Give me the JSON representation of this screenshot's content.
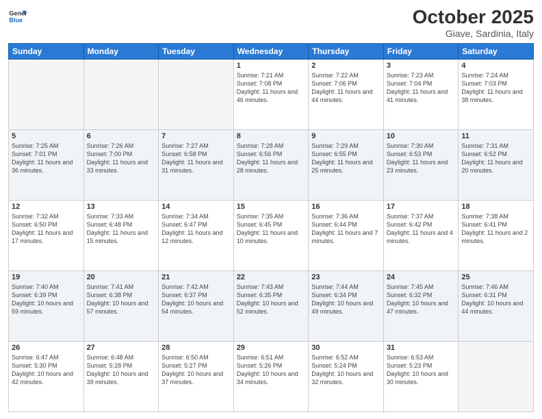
{
  "header": {
    "logo_line1": "General",
    "logo_line2": "Blue",
    "month_title": "October 2025",
    "location": "Giave, Sardinia, Italy"
  },
  "weekdays": [
    "Sunday",
    "Monday",
    "Tuesday",
    "Wednesday",
    "Thursday",
    "Friday",
    "Saturday"
  ],
  "weeks": [
    [
      {
        "day": "",
        "sunrise": "",
        "sunset": "",
        "daylight": ""
      },
      {
        "day": "",
        "sunrise": "",
        "sunset": "",
        "daylight": ""
      },
      {
        "day": "",
        "sunrise": "",
        "sunset": "",
        "daylight": ""
      },
      {
        "day": "1",
        "sunrise": "7:21 AM",
        "sunset": "7:08 PM",
        "daylight": "11 hours and 46 minutes."
      },
      {
        "day": "2",
        "sunrise": "7:22 AM",
        "sunset": "7:06 PM",
        "daylight": "11 hours and 44 minutes."
      },
      {
        "day": "3",
        "sunrise": "7:23 AM",
        "sunset": "7:04 PM",
        "daylight": "11 hours and 41 minutes."
      },
      {
        "day": "4",
        "sunrise": "7:24 AM",
        "sunset": "7:03 PM",
        "daylight": "11 hours and 38 minutes."
      }
    ],
    [
      {
        "day": "5",
        "sunrise": "7:25 AM",
        "sunset": "7:01 PM",
        "daylight": "11 hours and 36 minutes."
      },
      {
        "day": "6",
        "sunrise": "7:26 AM",
        "sunset": "7:00 PM",
        "daylight": "11 hours and 33 minutes."
      },
      {
        "day": "7",
        "sunrise": "7:27 AM",
        "sunset": "6:58 PM",
        "daylight": "11 hours and 31 minutes."
      },
      {
        "day": "8",
        "sunrise": "7:28 AM",
        "sunset": "6:56 PM",
        "daylight": "11 hours and 28 minutes."
      },
      {
        "day": "9",
        "sunrise": "7:29 AM",
        "sunset": "6:55 PM",
        "daylight": "11 hours and 25 minutes."
      },
      {
        "day": "10",
        "sunrise": "7:30 AM",
        "sunset": "6:53 PM",
        "daylight": "11 hours and 23 minutes."
      },
      {
        "day": "11",
        "sunrise": "7:31 AM",
        "sunset": "6:52 PM",
        "daylight": "11 hours and 20 minutes."
      }
    ],
    [
      {
        "day": "12",
        "sunrise": "7:32 AM",
        "sunset": "6:50 PM",
        "daylight": "11 hours and 17 minutes."
      },
      {
        "day": "13",
        "sunrise": "7:33 AM",
        "sunset": "6:48 PM",
        "daylight": "11 hours and 15 minutes."
      },
      {
        "day": "14",
        "sunrise": "7:34 AM",
        "sunset": "6:47 PM",
        "daylight": "11 hours and 12 minutes."
      },
      {
        "day": "15",
        "sunrise": "7:35 AM",
        "sunset": "6:45 PM",
        "daylight": "11 hours and 10 minutes."
      },
      {
        "day": "16",
        "sunrise": "7:36 AM",
        "sunset": "6:44 PM",
        "daylight": "11 hours and 7 minutes."
      },
      {
        "day": "17",
        "sunrise": "7:37 AM",
        "sunset": "6:42 PM",
        "daylight": "11 hours and 4 minutes."
      },
      {
        "day": "18",
        "sunrise": "7:38 AM",
        "sunset": "6:41 PM",
        "daylight": "11 hours and 2 minutes."
      }
    ],
    [
      {
        "day": "19",
        "sunrise": "7:40 AM",
        "sunset": "6:39 PM",
        "daylight": "10 hours and 59 minutes."
      },
      {
        "day": "20",
        "sunrise": "7:41 AM",
        "sunset": "6:38 PM",
        "daylight": "10 hours and 57 minutes."
      },
      {
        "day": "21",
        "sunrise": "7:42 AM",
        "sunset": "6:37 PM",
        "daylight": "10 hours and 54 minutes."
      },
      {
        "day": "22",
        "sunrise": "7:43 AM",
        "sunset": "6:35 PM",
        "daylight": "10 hours and 52 minutes."
      },
      {
        "day": "23",
        "sunrise": "7:44 AM",
        "sunset": "6:34 PM",
        "daylight": "10 hours and 49 minutes."
      },
      {
        "day": "24",
        "sunrise": "7:45 AM",
        "sunset": "6:32 PM",
        "daylight": "10 hours and 47 minutes."
      },
      {
        "day": "25",
        "sunrise": "7:46 AM",
        "sunset": "6:31 PM",
        "daylight": "10 hours and 44 minutes."
      }
    ],
    [
      {
        "day": "26",
        "sunrise": "6:47 AM",
        "sunset": "5:30 PM",
        "daylight": "10 hours and 42 minutes."
      },
      {
        "day": "27",
        "sunrise": "6:48 AM",
        "sunset": "5:28 PM",
        "daylight": "10 hours and 39 minutes."
      },
      {
        "day": "28",
        "sunrise": "6:50 AM",
        "sunset": "5:27 PM",
        "daylight": "10 hours and 37 minutes."
      },
      {
        "day": "29",
        "sunrise": "6:51 AM",
        "sunset": "5:26 PM",
        "daylight": "10 hours and 34 minutes."
      },
      {
        "day": "30",
        "sunrise": "6:52 AM",
        "sunset": "5:24 PM",
        "daylight": "10 hours and 32 minutes."
      },
      {
        "day": "31",
        "sunrise": "6:53 AM",
        "sunset": "5:23 PM",
        "daylight": "10 hours and 30 minutes."
      },
      {
        "day": "",
        "sunrise": "",
        "sunset": "",
        "daylight": ""
      }
    ]
  ],
  "labels": {
    "sunrise_prefix": "Sunrise: ",
    "sunset_prefix": "Sunset: ",
    "daylight_prefix": "Daylight: "
  }
}
